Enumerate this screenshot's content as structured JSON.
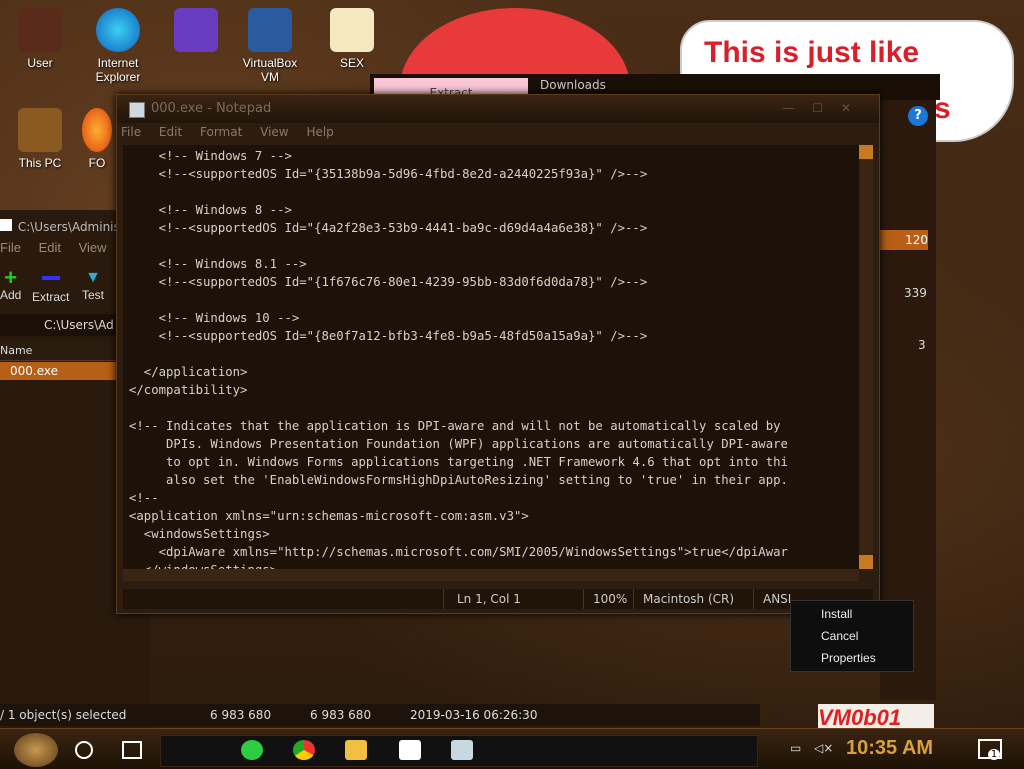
{
  "desktop": {
    "icons": [
      {
        "label": "User"
      },
      {
        "label": "Internet Explorer"
      },
      {
        "label": "VS"
      },
      {
        "label": "VirtualBox VM"
      },
      {
        "label": "SEX"
      },
      {
        "label": "This PC"
      },
      {
        "label": "FO"
      }
    ],
    "balloon_text_1": "This is just like",
    "balloon_text_2": "s"
  },
  "explorer_back": {
    "tab_extract": "Extract",
    "tab_downloads": "Downloads"
  },
  "zip_window": {
    "title": "C:\\Users\\Adminis",
    "menu": [
      "File",
      "Edit",
      "View",
      "F"
    ],
    "tools": [
      "Add",
      "Extract",
      "Test"
    ],
    "address": "C:\\Users\\Ad",
    "column_name": "Name",
    "row_file": "000.exe",
    "status_selected": "/ 1 object(s) selected",
    "status_size1": "6 983 680",
    "status_size2": "6 983 680",
    "status_date": "2019-03-16 06:26:30"
  },
  "right_panel": {
    "badge": "120",
    "num1": "339",
    "num2": "3",
    "help": "?"
  },
  "notepad": {
    "title": "000.exe - Notepad",
    "menu": [
      "File",
      "Edit",
      "Format",
      "View",
      "Help"
    ],
    "content": "    <!-- Windows 7 -->\n    <!--<supportedOS Id=\"{35138b9a-5d96-4fbd-8e2d-a2440225f93a}\" />-->\n\n    <!-- Windows 8 -->\n    <!--<supportedOS Id=\"{4a2f28e3-53b9-4441-ba9c-d69d4a4a6e38}\" />-->\n\n    <!-- Windows 8.1 -->\n    <!--<supportedOS Id=\"{1f676c76-80e1-4239-95bb-83d0f6d0da78}\" />-->\n\n    <!-- Windows 10 -->\n    <!--<supportedOS Id=\"{8e0f7a12-bfb3-4fe8-b9a5-48fd50a15a9a}\" />-->\n\n  </application>\n</compatibility>\n\n<!-- Indicates that the application is DPI-aware and will not be automatically scaled by\n     DPIs. Windows Presentation Foundation (WPF) applications are automatically DPI-aware\n     to opt in. Windows Forms applications targeting .NET Framework 4.6 that opt into thi\n     also set the 'EnableWindowsFormsHighDpiAutoResizing' setting to 'true' in their app.\n<!--\n<application xmlns=\"urn:schemas-microsoft-com:asm.v3\">\n  <windowsSettings>\n    <dpiAware xmlns=\"http://schemas.microsoft.com/SMI/2005/WindowsSettings\">true</dpiAwar\n  </windowsSettings>",
    "status_pos": "Ln 1, Col 1",
    "status_zoom": "100%",
    "status_eol": "Macintosh (CR)",
    "status_enc": "ANSI"
  },
  "context_menu": {
    "items": [
      "Install",
      "Cancel",
      "Properties"
    ]
  },
  "vm_logo": "VM0b01",
  "taskbar": {
    "clock": "10:35 AM",
    "notif_count": "1"
  }
}
